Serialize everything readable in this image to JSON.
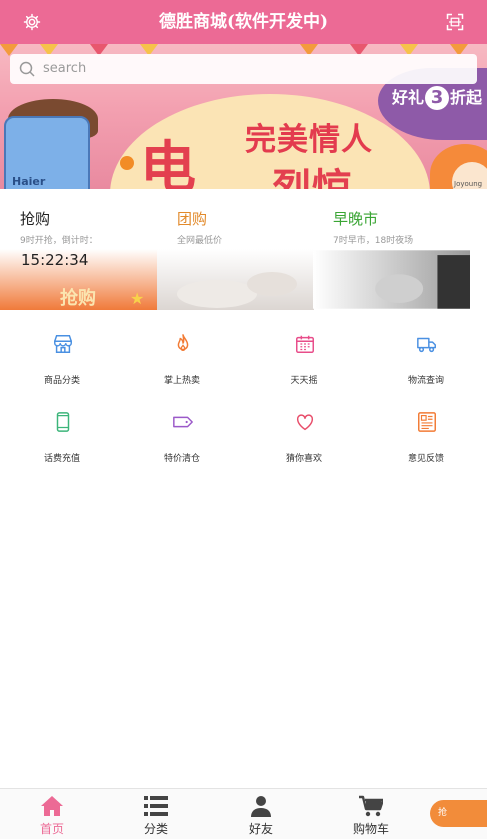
{
  "header": {
    "title": "德胜商城(软件开发中)"
  },
  "search": {
    "placeholder": "search"
  },
  "banner": {
    "promo_prefix": "好礼",
    "promo_number": "3",
    "promo_suffix": "折起",
    "headline": "完美情人",
    "big_char_1": "电",
    "big_char_2": "烈惊",
    "fridge_brand": "Haier",
    "corner_brand": "Joyoung"
  },
  "deals": [
    {
      "title": "抢购",
      "subtitle": "9时开抢，倒计时：",
      "countdown": "15:22:34",
      "title_color": "#222222",
      "image_text": "抢购"
    },
    {
      "title": "团购",
      "subtitle": "全网最低价",
      "title_color": "#e28a2b"
    },
    {
      "title": "早晚市",
      "subtitle": "7时早市，18时夜场",
      "title_color": "#3aa534"
    }
  ],
  "grid": [
    {
      "label": "商品分类",
      "icon": "store-icon",
      "color": "#4a90e2"
    },
    {
      "label": "掌上热卖",
      "icon": "fire-icon",
      "color": "#f27b35"
    },
    {
      "label": "天天摇",
      "icon": "calendar-icon",
      "color": "#e84d8a"
    },
    {
      "label": "物流查询",
      "icon": "truck-icon",
      "color": "#4a90e2"
    },
    {
      "label": "话费充值",
      "icon": "phone-icon",
      "color": "#3cb57a"
    },
    {
      "label": "特价清仓",
      "icon": "tag-icon",
      "color": "#9b59c9"
    },
    {
      "label": "猜你喜欢",
      "icon": "heart-icon",
      "color": "#e84d6a"
    },
    {
      "label": "意见反馈",
      "icon": "feedback-icon",
      "color": "#f27b35"
    }
  ],
  "tabbar": [
    {
      "label": "首页",
      "icon": "home-icon",
      "active": true
    },
    {
      "label": "分类",
      "icon": "list-icon",
      "active": false
    },
    {
      "label": "好友",
      "icon": "user-icon",
      "active": false
    },
    {
      "label": "购物车",
      "icon": "cart-icon",
      "active": false
    }
  ],
  "floating": {
    "grab_label": "抢"
  },
  "colors": {
    "brand": "#ec6a95",
    "active_tab": "#ec6a95"
  }
}
